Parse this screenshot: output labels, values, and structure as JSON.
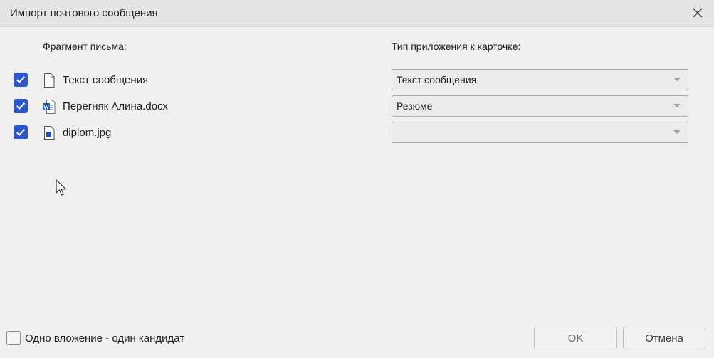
{
  "window": {
    "title": "Импорт почтового сообщения"
  },
  "headers": {
    "fragment": "Фрагмент письма:",
    "attach_type": "Тип приложения к карточке:"
  },
  "items": [
    {
      "name": "Текст сообщения",
      "checked": true,
      "icon": "document-icon",
      "type": "Текст сообщения"
    },
    {
      "name": "Перегняк Алина.docx",
      "checked": true,
      "icon": "word-icon",
      "type": "Резюме"
    },
    {
      "name": "diplom.jpg",
      "checked": true,
      "icon": "image-file-icon",
      "type": ""
    }
  ],
  "footer": {
    "one_attachment_label": "Одно вложение - один кандидат",
    "one_attachment_checked": false,
    "ok_label": "OK",
    "cancel_label": "Отмена"
  },
  "colors": {
    "checkbox_accent": "#2e56c8",
    "titlebar": "#e4e4e7",
    "background": "#f0f0f0"
  }
}
